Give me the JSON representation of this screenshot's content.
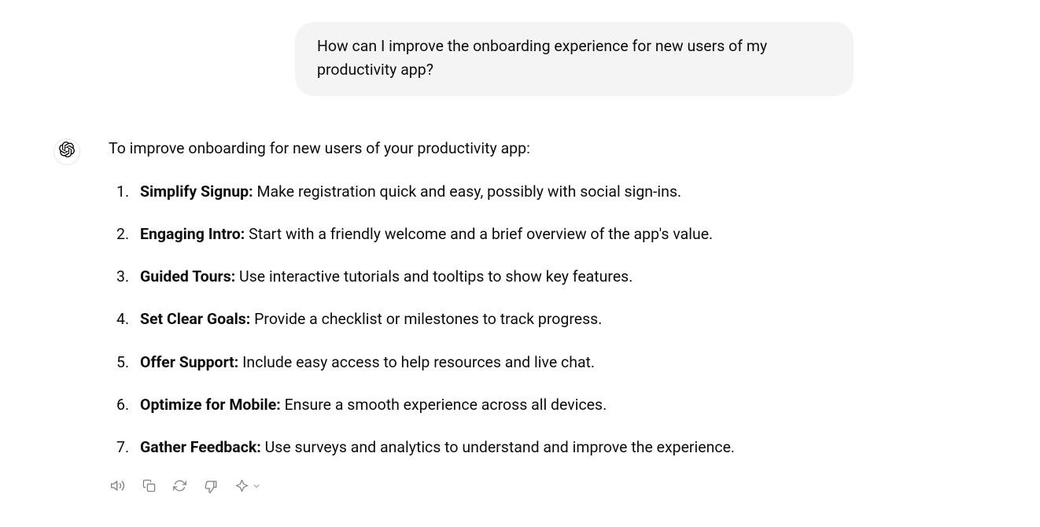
{
  "user": {
    "message": "How can I improve the onboarding experience for new users of my productivity app?"
  },
  "assistant": {
    "intro": "To improve onboarding for new users of your productivity app:",
    "items": [
      {
        "title": "Simplify Signup:",
        "text": " Make registration quick and easy, possibly with social sign-ins."
      },
      {
        "title": "Engaging Intro:",
        "text": " Start with a friendly welcome and a brief overview of the app's value."
      },
      {
        "title": "Guided Tours:",
        "text": " Use interactive tutorials and tooltips to show key features."
      },
      {
        "title": "Set Clear Goals:",
        "text": " Provide a checklist or milestones to track progress."
      },
      {
        "title": "Offer Support:",
        "text": " Include easy access to help resources and live chat."
      },
      {
        "title": "Optimize for Mobile:",
        "text": " Ensure a smooth experience across all devices."
      },
      {
        "title": "Gather Feedback:",
        "text": " Use surveys and analytics to understand and improve the experience."
      }
    ]
  }
}
